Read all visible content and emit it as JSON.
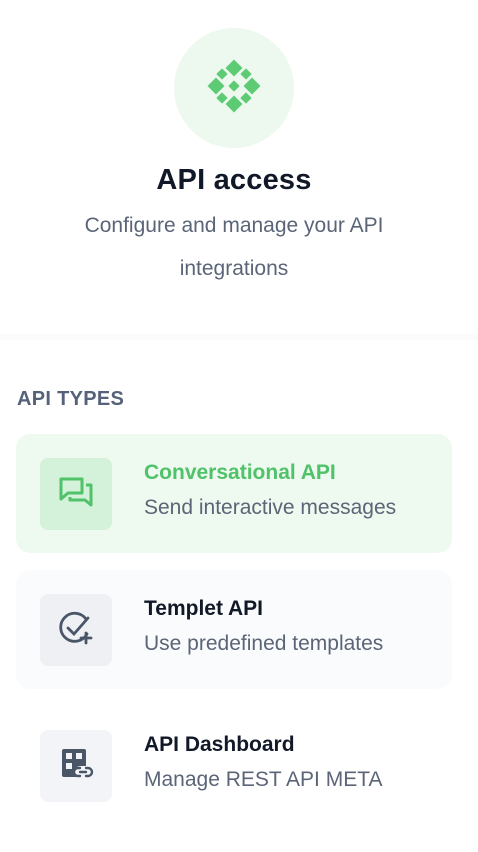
{
  "header": {
    "title": "API access",
    "subtitle": "Configure and manage your API integrations",
    "logo_icon": "diamond-grid-icon"
  },
  "section": {
    "label": "API TYPES"
  },
  "api_types": [
    {
      "title": "Conversational API",
      "description": "Send interactive messages",
      "icon": "chat-bubbles-icon",
      "selected": true
    },
    {
      "title": "Templet API",
      "description": "Use predefined templates",
      "icon": "check-circle-plus-icon",
      "selected": false
    },
    {
      "title": "API Dashboard",
      "description": "Manage REST API META",
      "icon": "dashboard-link-icon",
      "selected": false
    }
  ],
  "colors": {
    "accent_green": "#4fc26a",
    "accent_bg": "#eef9ef",
    "icon_slate": "#4a5568"
  }
}
